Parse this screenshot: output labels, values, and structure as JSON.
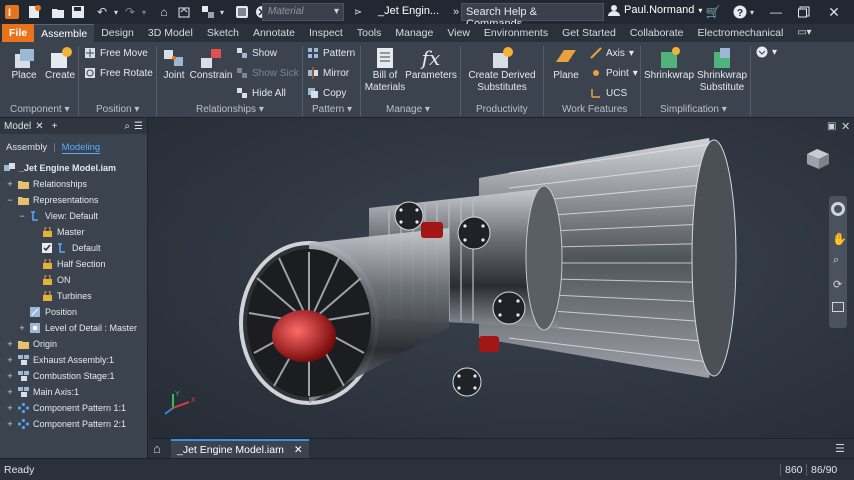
{
  "titlebar": {
    "material_placeholder": "Material",
    "filename": "_Jet Engin...",
    "search_text": "Search Help & Commands...",
    "user": "Paul.Normand"
  },
  "menu": {
    "tabs": [
      "File",
      "Assemble",
      "Design",
      "3D Model",
      "Sketch",
      "Annotate",
      "Inspect",
      "Tools",
      "Manage",
      "View",
      "Environments",
      "Get Started",
      "Collaborate",
      "Electromechanical"
    ],
    "active_tab": "Assemble"
  },
  "ribbon": {
    "component": {
      "place": "Place",
      "create": "Create",
      "label": "Component"
    },
    "position": {
      "free_move": "Free Move",
      "free_rotate": "Free Rotate",
      "label": "Position"
    },
    "relationships": {
      "joint": "Joint",
      "constrain": "Constrain",
      "show": "Show",
      "show_sick": "Show Sick",
      "hide_all": "Hide All",
      "label": "Relationships"
    },
    "pattern": {
      "pattern": "Pattern",
      "mirror": "Mirror",
      "copy": "Copy",
      "label": "Pattern"
    },
    "manage": {
      "bom_line1": "Bill of",
      "bom_line2": "Materials",
      "parameters": "Parameters",
      "label": "Manage"
    },
    "productivity": {
      "cds_line1": "Create Derived",
      "cds_line2": "Substitutes",
      "label": "Productivity"
    },
    "work_features": {
      "plane": "Plane",
      "axis": "Axis",
      "point": "Point",
      "ucs": "UCS",
      "label": "Work Features"
    },
    "simplification": {
      "shrinkwrap": "Shrinkwrap",
      "sws_line1": "Shrinkwrap",
      "sws_line2": "Substitute",
      "label": "Simplification"
    }
  },
  "browser": {
    "header": "Model",
    "tabs": [
      "Assembly",
      "Modeling"
    ],
    "root": "_Jet Engine Model.iam",
    "nodes": [
      "Relationships",
      "Representations",
      "View: Default",
      "Master",
      "Default",
      "Half Section",
      "ON",
      "Turbines",
      "Position",
      "Level of Detail : Master",
      "Origin",
      "Exhaust Assembly:1",
      "Combustion Stage:1",
      "Main Axis:1",
      "Component Pattern 1:1",
      "Component Pattern 2:1"
    ]
  },
  "document_tab": "_Jet Engine Model.iam",
  "status": {
    "text": "Ready",
    "count1": "860",
    "count2": "86/90"
  },
  "colors": {
    "accent": "#e8731a",
    "active_tab_line": "#3d8ee6",
    "link": "#5aa9ff"
  }
}
